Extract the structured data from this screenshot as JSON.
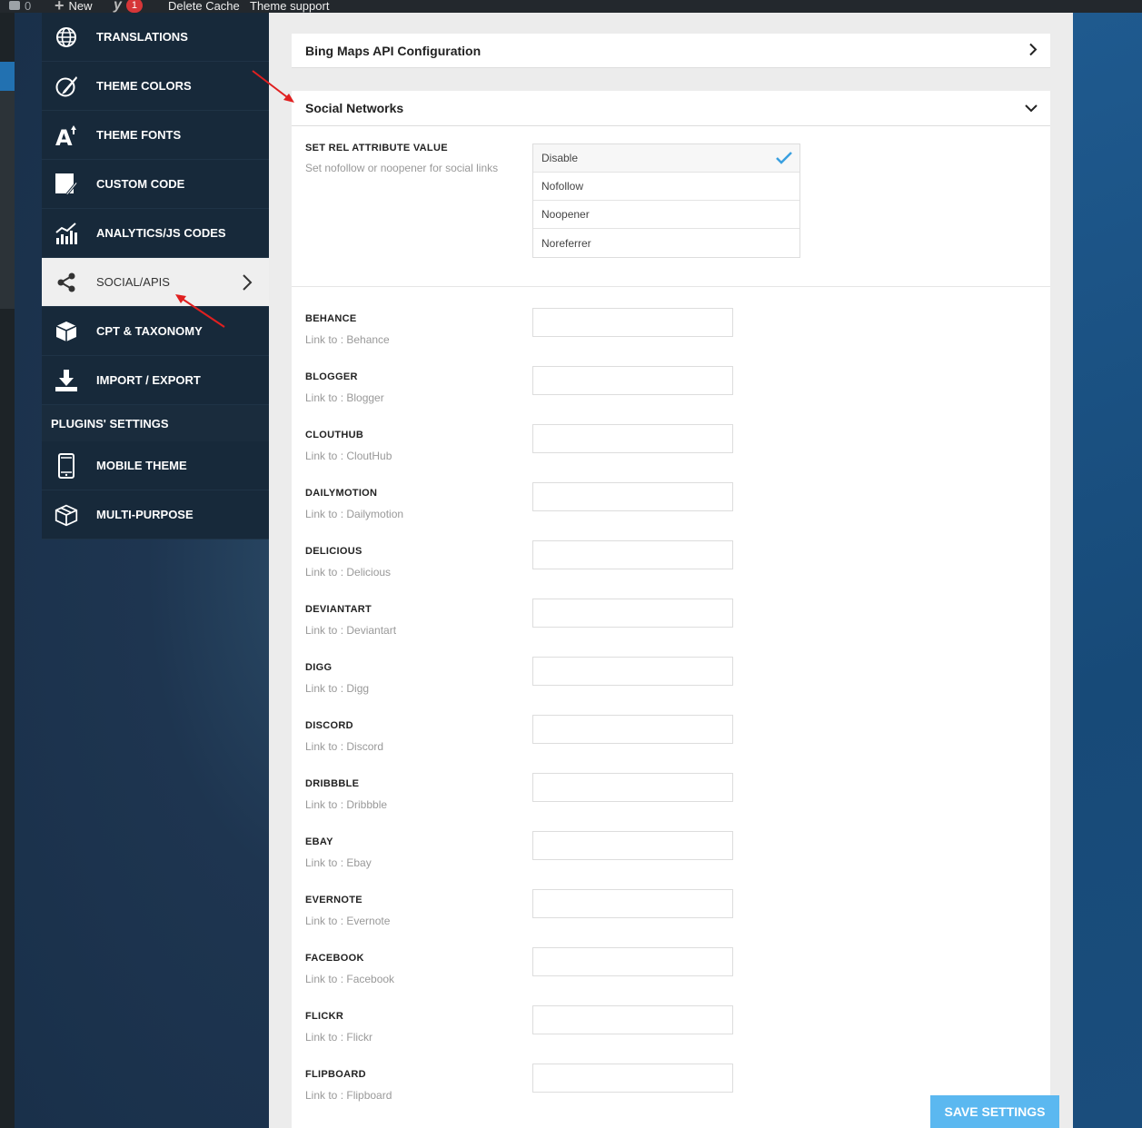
{
  "adminbar": {
    "comments_count": "0",
    "new_label": "New",
    "yoast_badge": "1",
    "delete_cache_label": "Delete Cache",
    "theme_support_label": "Theme support"
  },
  "sidebar": {
    "items": [
      {
        "label": "TRANSLATIONS",
        "icon": "globe-icon"
      },
      {
        "label": "THEME COLORS",
        "icon": "paint-brush-icon"
      },
      {
        "label": "THEME FONTS",
        "icon": "font-size-icon"
      },
      {
        "label": "CUSTOM CODE",
        "icon": "code-pen-icon"
      },
      {
        "label": "ANALYTICS/JS CODES",
        "icon": "analytics-chart-icon"
      },
      {
        "label": "SOCIAL/APIS",
        "icon": "share-icon",
        "active": true
      },
      {
        "label": "CPT & TAXONOMY",
        "icon": "cube-icon"
      },
      {
        "label": "IMPORT / EXPORT",
        "icon": "download-icon"
      }
    ],
    "plugins_heading": "PLUGINS' SETTINGS",
    "plugin_items": [
      {
        "label": "MOBILE THEME",
        "icon": "mobile-icon"
      },
      {
        "label": "MULTI-PURPOSE",
        "icon": "box-icon"
      }
    ]
  },
  "main": {
    "bing_title": "Bing Maps API Configuration",
    "social_title": "Social Networks",
    "rel": {
      "title": "SET REL ATTRIBUTE VALUE",
      "desc": "Set nofollow or noopener for social links",
      "options": [
        "Disable",
        "Nofollow",
        "Noopener",
        "Noreferrer"
      ],
      "selected": "Disable"
    },
    "networks": [
      {
        "title": "BEHANCE",
        "desc": "Link to : Behance",
        "value": ""
      },
      {
        "title": "BLOGGER",
        "desc": "Link to : Blogger",
        "value": ""
      },
      {
        "title": "CLOUTHUB",
        "desc": "Link to : CloutHub",
        "value": ""
      },
      {
        "title": "DAILYMOTION",
        "desc": "Link to : Dailymotion",
        "value": ""
      },
      {
        "title": "DELICIOUS",
        "desc": "Link to : Delicious",
        "value": ""
      },
      {
        "title": "DEVIANTART",
        "desc": "Link to : Deviantart",
        "value": ""
      },
      {
        "title": "DIGG",
        "desc": "Link to : Digg",
        "value": ""
      },
      {
        "title": "DISCORD",
        "desc": "Link to : Discord",
        "value": ""
      },
      {
        "title": "DRIBBBLE",
        "desc": "Link to : Dribbble",
        "value": ""
      },
      {
        "title": "EBAY",
        "desc": "Link to : Ebay",
        "value": ""
      },
      {
        "title": "EVERNOTE",
        "desc": "Link to : Evernote",
        "value": ""
      },
      {
        "title": "FACEBOOK",
        "desc": "Link to : Facebook",
        "value": ""
      },
      {
        "title": "FLICKR",
        "desc": "Link to : Flickr",
        "value": ""
      },
      {
        "title": "FLIPBOARD",
        "desc": "Link to : Flipboard",
        "value": ""
      }
    ],
    "save_label": "SAVE SETTINGS"
  },
  "colors": {
    "accent": "#5bb8f0",
    "sidebar_bg": "#17293a",
    "annotation_arrow": "#e02020"
  }
}
